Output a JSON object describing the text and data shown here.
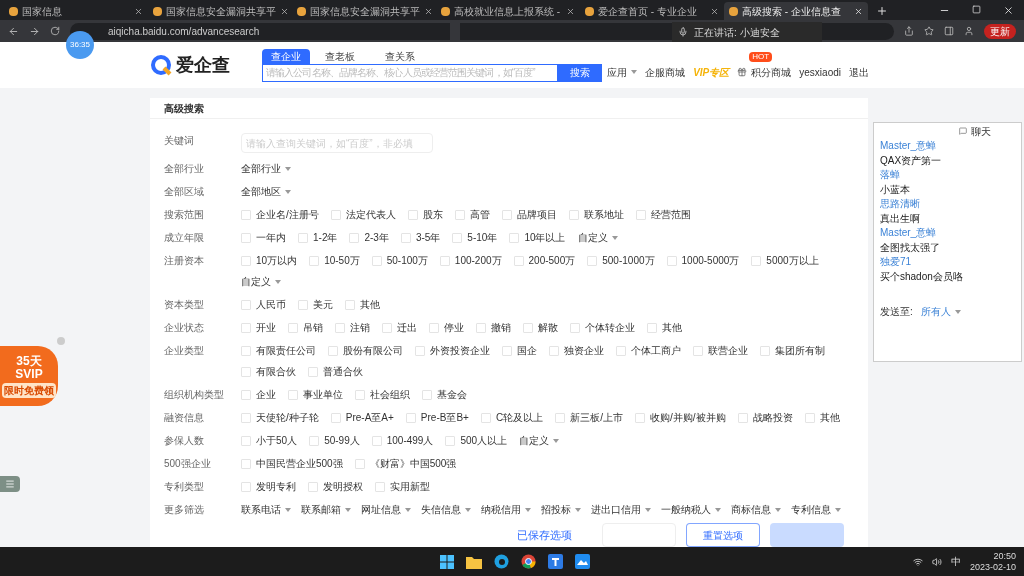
{
  "browser": {
    "tabs": [
      {
        "title": "国家信息",
        "selected": false
      },
      {
        "title": "国家信息安全漏洞共享平",
        "selected": false
      },
      {
        "title": "国家信息安全漏洞共享平",
        "selected": false
      },
      {
        "title": "高校就业信息上报系统 -",
        "selected": false
      },
      {
        "title": "爱企查首页 - 专业企业",
        "selected": false
      },
      {
        "title": "高级搜索 - 企业信息查",
        "selected": true
      }
    ],
    "url": "aiqicha.baidu.com/advancesearch",
    "update_button": "更新"
  },
  "meeting": {
    "timer": "36:35",
    "speaking": "正在讲话: 小迪安全"
  },
  "site": {
    "logo": "爱企查",
    "search_tabs": [
      {
        "label": "查企业",
        "selected": true
      },
      {
        "label": "查老板",
        "selected": false
      },
      {
        "label": "查关系",
        "selected": false
      }
    ],
    "search_placeholder": "请输入公司名称、品牌名称、核心人员或经营范围关键词，如“百度”",
    "search_button": "搜索",
    "nav": [
      {
        "label": "应用",
        "kind": "menu"
      },
      {
        "label": "企服商城",
        "kind": "link"
      },
      {
        "label": "VIP专区",
        "kind": "vip"
      },
      {
        "label": "积分商城",
        "kind": "hot",
        "badge": "HOT"
      },
      {
        "label": "yesxiaodi",
        "kind": "link"
      },
      {
        "label": "退出",
        "kind": "link"
      }
    ]
  },
  "form": {
    "title": "高级搜索",
    "rows": [
      {
        "label": "关键词",
        "kind": "input",
        "placeholder": "请输入查询关键词，如“百度”，非必填"
      },
      {
        "label": "全部行业",
        "kind": "dropdown",
        "value": "全部行业"
      },
      {
        "label": "全部区域",
        "kind": "dropdown",
        "value": "全部地区"
      },
      {
        "label": "搜索范围",
        "kind": "checks",
        "options": [
          {
            "label": "企业名/注册号",
            "checked": false
          },
          {
            "label": "法定代表人",
            "checked": false
          },
          {
            "label": "股东",
            "checked": false
          },
          {
            "label": "高管",
            "checked": false
          },
          {
            "label": "品牌项目",
            "checked": false
          },
          {
            "label": "联系地址",
            "checked": false
          },
          {
            "label": "经营范围",
            "checked": false
          }
        ]
      },
      {
        "label": "成立年限",
        "kind": "checks",
        "options": [
          {
            "label": "一年内",
            "checked": false
          },
          {
            "label": "1-2年",
            "checked": false
          },
          {
            "label": "2-3年",
            "checked": false
          },
          {
            "label": "3-5年",
            "checked": false
          },
          {
            "label": "5-10年",
            "checked": false
          },
          {
            "label": "10年以上",
            "checked": false
          }
        ],
        "custom": "自定义"
      },
      {
        "label": "注册资本",
        "kind": "checks",
        "options": [
          {
            "label": "10万以内",
            "checked": false
          },
          {
            "label": "10-50万",
            "checked": false
          },
          {
            "label": "50-100万",
            "checked": false
          },
          {
            "label": "100-200万",
            "checked": false
          },
          {
            "label": "200-500万",
            "checked": false
          },
          {
            "label": "500-1000万",
            "checked": false
          },
          {
            "label": "1000-5000万",
            "checked": false
          },
          {
            "label": "5000万以上",
            "checked": false
          }
        ],
        "custom": "自定义"
      },
      {
        "label": "资本类型",
        "kind": "checks",
        "options": [
          {
            "label": "人民币",
            "checked": false
          },
          {
            "label": "美元",
            "checked": false
          },
          {
            "label": "其他",
            "checked": false
          }
        ]
      },
      {
        "label": "企业状态",
        "kind": "checks",
        "options": [
          {
            "label": "开业",
            "checked": false
          },
          {
            "label": "吊销",
            "checked": false
          },
          {
            "label": "注销",
            "checked": false
          },
          {
            "label": "迁出",
            "checked": false
          },
          {
            "label": "停业",
            "checked": false
          },
          {
            "label": "撤销",
            "checked": false
          },
          {
            "label": "解散",
            "checked": false
          },
          {
            "label": "个体转企业",
            "checked": false
          },
          {
            "label": "其他",
            "checked": false
          }
        ]
      },
      {
        "label": "企业类型",
        "kind": "checks",
        "options": [
          {
            "label": "有限责任公司",
            "checked": false
          },
          {
            "label": "股份有限公司",
            "checked": false
          },
          {
            "label": "外资投资企业",
            "checked": false
          },
          {
            "label": "国企",
            "checked": false
          },
          {
            "label": "独资企业",
            "checked": false
          },
          {
            "label": "个体工商户",
            "checked": false
          },
          {
            "label": "联营企业",
            "checked": false
          },
          {
            "label": "集团所有制",
            "checked": false
          },
          {
            "label": "有限合伙",
            "checked": false
          },
          {
            "label": "普通合伙",
            "checked": false
          }
        ]
      },
      {
        "label": "组织机构类型",
        "kind": "checks",
        "options": [
          {
            "label": "企业",
            "checked": false
          },
          {
            "label": "事业单位",
            "checked": false
          },
          {
            "label": "社会组织",
            "checked": false
          },
          {
            "label": "基金会",
            "checked": false
          }
        ]
      },
      {
        "label": "融资信息",
        "kind": "checks",
        "options": [
          {
            "label": "天使轮/种子轮",
            "checked": false
          },
          {
            "label": "Pre-A至A+",
            "checked": false
          },
          {
            "label": "Pre-B至B+",
            "checked": false
          },
          {
            "label": "C轮及以上",
            "checked": false
          },
          {
            "label": "新三板/上市",
            "checked": false
          },
          {
            "label": "收购/并购/被并购",
            "checked": false
          },
          {
            "label": "战略投资",
            "checked": false
          },
          {
            "label": "其他",
            "checked": false
          }
        ]
      },
      {
        "label": "参保人数",
        "kind": "checks",
        "options": [
          {
            "label": "小于50人",
            "checked": false
          },
          {
            "label": "50-99人",
            "checked": false
          },
          {
            "label": "100-499人",
            "checked": false
          },
          {
            "label": "500人以上",
            "checked": false
          }
        ],
        "custom": "自定义"
      },
      {
        "label": "500强企业",
        "kind": "checks",
        "options": [
          {
            "label": "中国民营企业500强",
            "checked": false
          },
          {
            "label": "《财富》中国500强",
            "checked": false
          }
        ]
      },
      {
        "label": "专利类型",
        "kind": "checks",
        "options": [
          {
            "label": "发明专利",
            "checked": false
          },
          {
            "label": "发明授权",
            "checked": false
          },
          {
            "label": "实用新型",
            "checked": false
          }
        ]
      },
      {
        "label": "更多筛选",
        "kind": "dropdowns",
        "options": [
          "联系电话",
          "联系邮箱",
          "网址信息",
          "失信信息",
          "纳税信用",
          "招投标",
          "进出口信用",
          "一般纳税人",
          "商标信息",
          "专利信息"
        ]
      }
    ],
    "actions": [
      {
        "kind": "link",
        "label": "已保存选项"
      },
      {
        "kind": "ghost"
      },
      {
        "kind": "outline",
        "label": "重置选项"
      },
      {
        "kind": "primary_disabled"
      }
    ]
  },
  "chat": {
    "title": "聊天",
    "messages": [
      {
        "sender": "Master_意蝉",
        "text": "QAX资产第一"
      },
      {
        "sender": "落蝉",
        "text": "小蓝本"
      },
      {
        "sender": "思路清晰",
        "text": "真出生啊"
      },
      {
        "sender": "Master_意蝉",
        "text": "全图找太强了"
      },
      {
        "sender": "独爱71",
        "text": "买个shadon会员咯"
      }
    ],
    "send_to_label": "发送至:",
    "send_to": "所有人"
  },
  "promo": {
    "days": "35天",
    "tier": "SVIP",
    "cta": "限时免费领"
  },
  "taskbar": {
    "ime": "中",
    "time": "20:50",
    "date": "2023-02-10"
  }
}
